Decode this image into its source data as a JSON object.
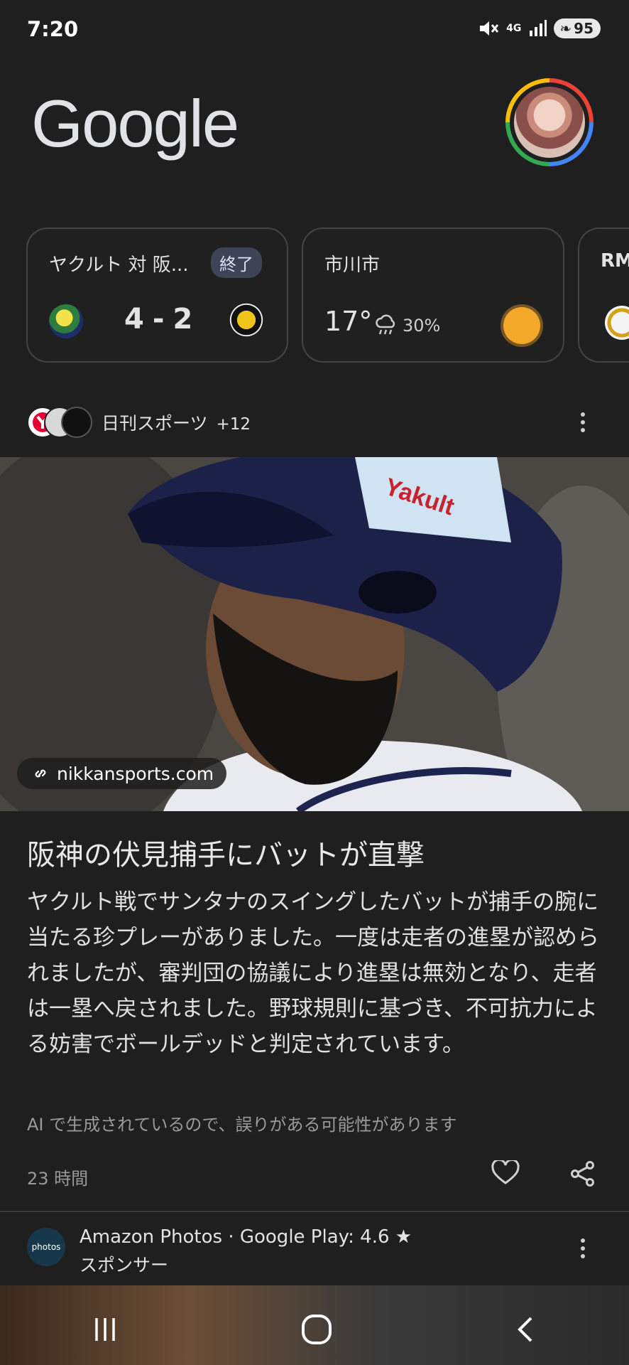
{
  "status_bar": {
    "time": "7:20",
    "network": "4G",
    "battery": "95"
  },
  "header": {
    "logo_text": "Google"
  },
  "cards": {
    "score": {
      "title": "ヤクルト 対 阪...",
      "badge": "終了",
      "home_score": "4",
      "separator": "-",
      "away_score": "2"
    },
    "weather": {
      "city": "市川市",
      "temperature": "17°",
      "precipitation": "30%"
    },
    "partial": {
      "title": "RM"
    }
  },
  "article": {
    "sources_text": "日刊スポーツ",
    "sources_extra": "+12",
    "url_chip": "nikkansports.com",
    "headline": "阪神の伏見捕手にバットが直撃",
    "body": "ヤクルト戦でサンタナのスイングしたバットが捕手の腕に当たる珍プレーがありました。一度は走者の進塁が認められましたが、審判団の協議により進塁は無効となり、走者は一塁へ戻されました。野球規則に基づき、不可抗力による妨害でボールデッドと判定されています。",
    "ai_note": "AI で生成されているので、誤りがある可能性があります",
    "time_ago": "23 時間"
  },
  "ad": {
    "logo_text": "photos",
    "title": "Amazon Photos · Google Play: 4.6 ★",
    "subtitle": "スポンサー"
  },
  "colors": {
    "background": "#1f1f1f",
    "badge_bg": "#3c4456",
    "sun": "#f4a82a"
  }
}
